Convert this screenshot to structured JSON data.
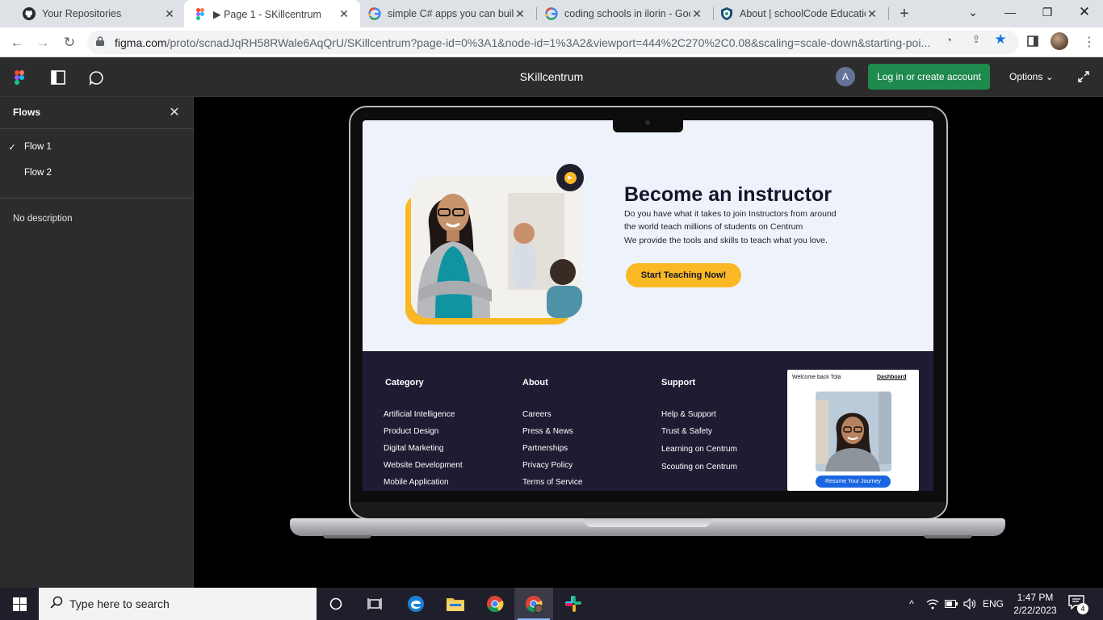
{
  "browser": {
    "tabs": [
      {
        "title": "Your Repositories",
        "icon": "github-icon"
      },
      {
        "title": "▶ Page 1 - SKillcentrum",
        "icon": "figma-icon",
        "active": true
      },
      {
        "title": "simple C# apps you can build",
        "icon": "google-icon"
      },
      {
        "title": "coding schools in ilorin - Goo",
        "icon": "google-icon"
      },
      {
        "title": "About | schoolCode Educatio",
        "icon": "shield-icon"
      }
    ],
    "url_host": "figma.com",
    "url_path": "/proto/scnadJqRH58RWale6AqQrU/SKillcentrum?page-id=0%3A1&node-id=1%3A2&viewport=444%2C270%2C0.08&scaling=scale-down&starting-poi..."
  },
  "figma": {
    "file_title": "SKillcentrum",
    "user_initial": "A",
    "login_label": "Log in or create account",
    "options_label": "Options"
  },
  "flows_panel": {
    "title": "Flows",
    "items": [
      {
        "label": "Flow 1",
        "checked": "✓"
      },
      {
        "label": "Flow 2",
        "checked": ""
      }
    ],
    "description": "No description"
  },
  "prototype": {
    "hero": {
      "title": "Become an instructor",
      "lines": [
        "Do you have what it takes to join Instructors from around",
        "the world teach millions of students on  Centrum",
        "We provide the tools and skills to teach what you love."
      ],
      "cta": "Start Teaching Now!"
    },
    "footer": {
      "columns": [
        {
          "heading": "Category",
          "items": [
            "Artificial Intelligence",
            "Product Design",
            "Digital Marketing",
            "Website Development",
            "Mobile Application"
          ]
        },
        {
          "heading": "About",
          "items": [
            "Careers",
            "Press & News",
            "Partnerships",
            "Privacy Policy",
            "Terms of Service"
          ]
        },
        {
          "heading": "Support",
          "items": [
            "Help & Support",
            "Trust & Safety",
            "Learning on Centrum",
            "Scouting  on Centrum"
          ]
        }
      ],
      "card": {
        "welcome": "Welcome back Tola",
        "dashboard": "Dashboard",
        "button": "Resume Your Journey"
      }
    }
  },
  "taskbar": {
    "search_placeholder": "Type here to search",
    "language": "ENG",
    "time": "1:47 PM",
    "date": "2/22/2023",
    "notification_count": "4"
  },
  "colors": {
    "figma_green": "#1f8a4d",
    "accent_yellow": "#f9b824",
    "footer_bg": "#1f1b33",
    "card_button": "#1a66e0"
  }
}
